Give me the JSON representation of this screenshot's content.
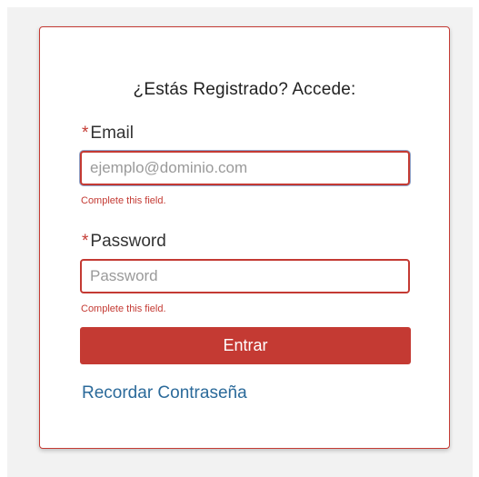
{
  "login": {
    "heading": "¿Estás Registrado? Accede:",
    "required_marker": "*",
    "email": {
      "label": "Email",
      "placeholder": "ejemplo@dominio.com",
      "value": "",
      "error": "Complete this field."
    },
    "password": {
      "label": "Password",
      "placeholder": "Password",
      "value": "",
      "error": "Complete this field."
    },
    "submit_label": "Entrar",
    "forgot_password_label": "Recordar Contraseña"
  },
  "colors": {
    "accent": "#c43a33",
    "link": "#2b6a9a",
    "page_background": "#f2f2f2"
  }
}
